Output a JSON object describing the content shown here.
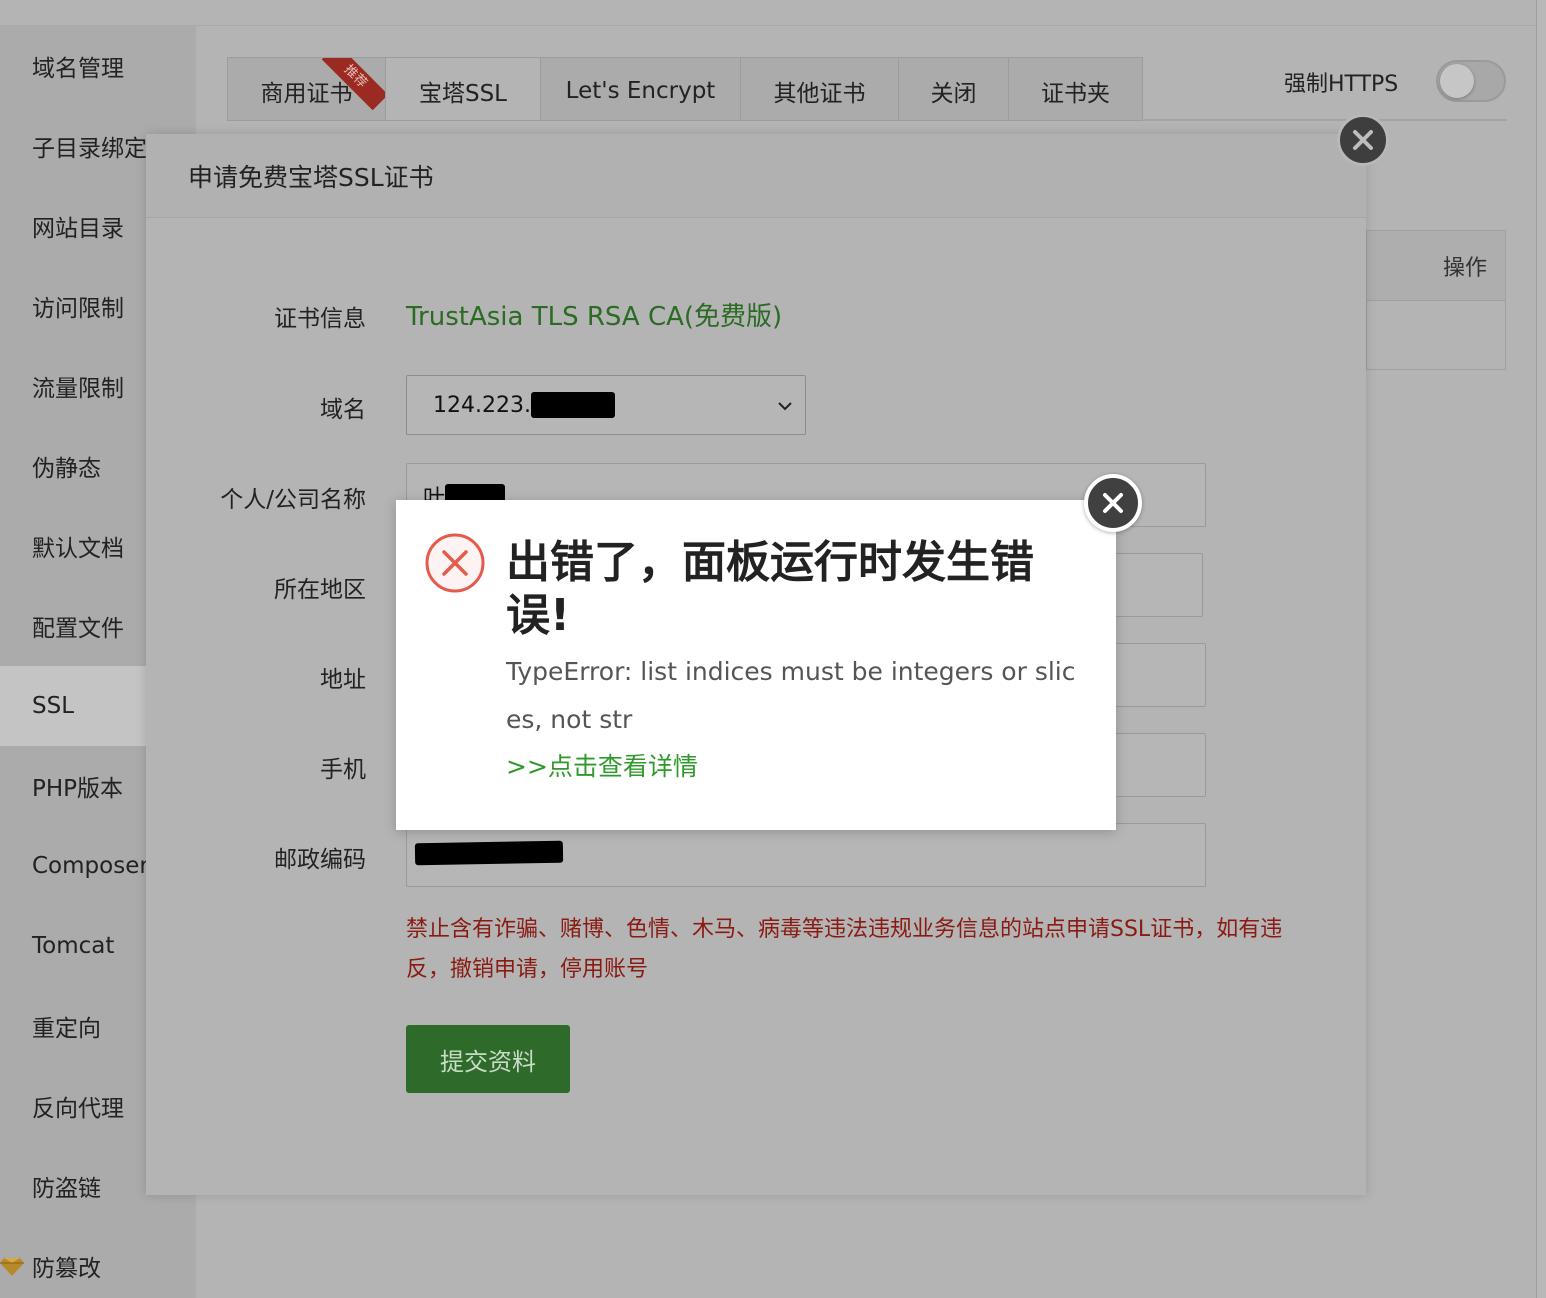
{
  "sidebar": {
    "items": [
      {
        "label": "域名管理"
      },
      {
        "label": "子目录绑定"
      },
      {
        "label": "网站目录"
      },
      {
        "label": "访问限制"
      },
      {
        "label": "流量限制"
      },
      {
        "label": "伪静态"
      },
      {
        "label": "默认文档"
      },
      {
        "label": "配置文件"
      },
      {
        "label": "SSL"
      },
      {
        "label": "PHP版本"
      },
      {
        "label": "Composer"
      },
      {
        "label": "Tomcat"
      },
      {
        "label": "重定向"
      },
      {
        "label": "反向代理"
      },
      {
        "label": "防盗链"
      },
      {
        "label": "防篡改"
      }
    ],
    "active_index": 8
  },
  "tabs": [
    {
      "label": "商用证书",
      "badge": "推荐"
    },
    {
      "label": "宝塔SSL"
    },
    {
      "label": "Let's Encrypt"
    },
    {
      "label": "其他证书"
    },
    {
      "label": "关闭"
    },
    {
      "label": "证书夹"
    }
  ],
  "selected_tab": 1,
  "force_https": {
    "label": "强制HTTPS",
    "enabled": false
  },
  "bg_table": {
    "header_action": "操作"
  },
  "modal": {
    "title": "申请免费宝塔SSL证书",
    "cert_info_label": "证书信息",
    "cert_info_value": "TrustAsia TLS RSA CA(免费版)",
    "domain_label": "域名",
    "domain_value": "124.223.",
    "name_label": "个人/公司名称",
    "name_value": "叶",
    "region_label": "所在地区",
    "address_label": "地址",
    "phone_label": "手机",
    "postal_label": "邮政编码",
    "warning": "禁止含有诈骗、赌博、色情、木马、病毒等违法违规业务信息的站点申请SSL证书，如有违反，撤销申请，停用账号",
    "submit_label": "提交资料"
  },
  "error_dialog": {
    "title": "出错了，面板运行时发生错误!",
    "detail": "TypeError: list indices must be integers or slices, not str",
    "link": ">>点击查看详情"
  },
  "colors": {
    "accent_green": "#20a53a",
    "error_red": "#e55b4b",
    "warning_red": "#b01e0e"
  }
}
